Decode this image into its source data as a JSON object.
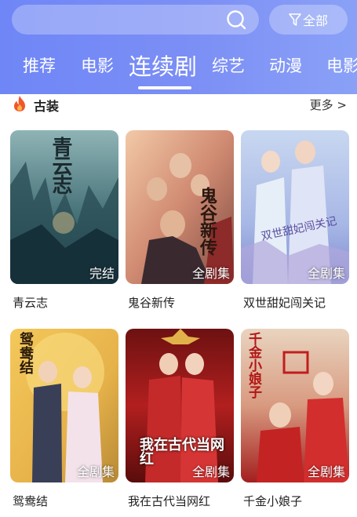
{
  "header": {
    "filter_label": "全部",
    "tabs": [
      "推荐",
      "电影",
      "连续剧",
      "综艺",
      "动漫",
      "电影"
    ],
    "active_tab": "连续剧"
  },
  "section": {
    "title": "古装",
    "more_label": "更多 >"
  },
  "shows": [
    {
      "title": "青云志",
      "badge": "完结"
    },
    {
      "title": "鬼谷新传",
      "badge": "全剧集"
    },
    {
      "title": "双世甜妃闯关记",
      "badge": "全剧集"
    },
    {
      "title": "鸳鸯结",
      "badge": "全剧集"
    },
    {
      "title": "我在古代当网红",
      "badge": "全剧集"
    },
    {
      "title": "千金小娘子",
      "badge": "全剧集"
    }
  ],
  "poster_text": [
    "青云志",
    "鬼谷新传",
    "双世甜妃闯关记",
    "鸳鸯结",
    "我在古代当网红",
    "千金小娘子"
  ],
  "colors": {
    "header": "#7c8ff5",
    "accent_fire": "#f0572b"
  }
}
